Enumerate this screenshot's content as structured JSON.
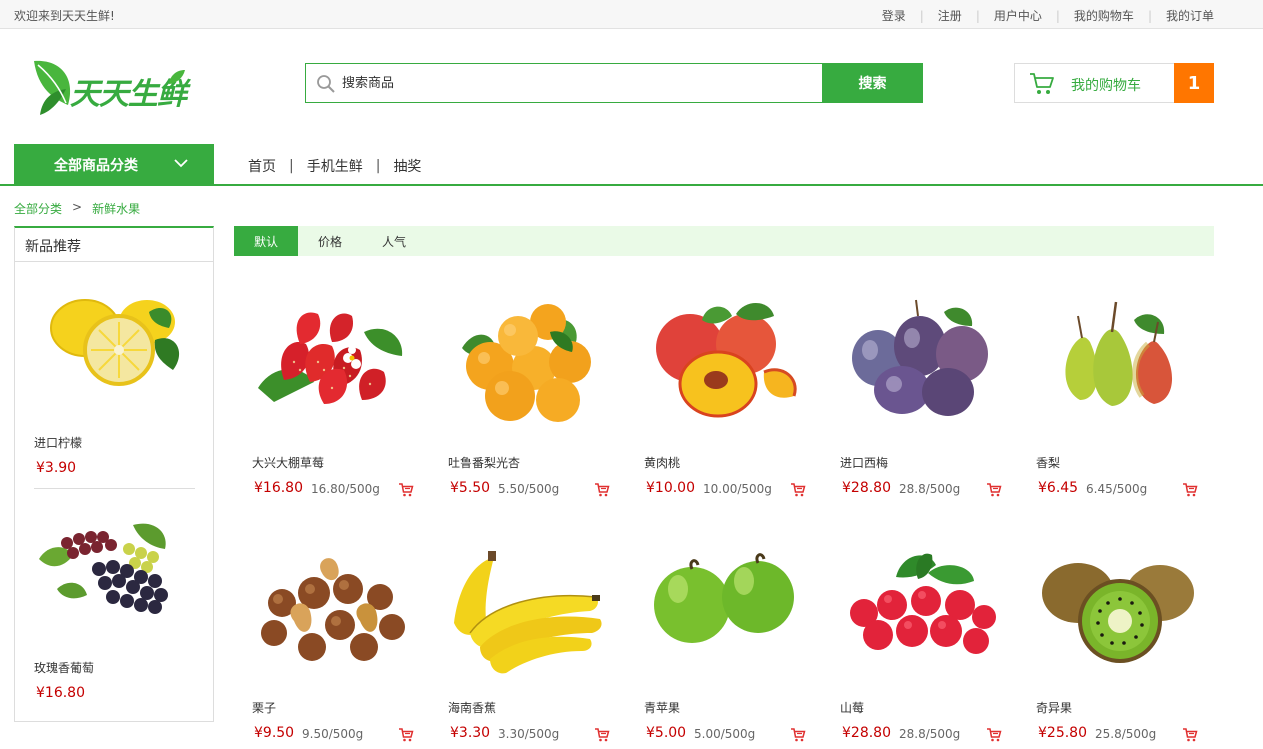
{
  "topbar": {
    "welcome": "欢迎来到天天生鲜!",
    "links": [
      "登录",
      "注册",
      "用户中心",
      "我的购物车",
      "我的订单"
    ]
  },
  "header": {
    "logo_text": "天天生鲜",
    "search_placeholder": "搜索商品",
    "search_button": "搜索",
    "cart_label": "我的购物车",
    "cart_count": "1"
  },
  "nav": {
    "all_categories": "全部商品分类",
    "links": [
      "首页",
      "手机生鲜",
      "抽奖"
    ]
  },
  "breadcrumb": {
    "root": "全部分类",
    "arrow": ">",
    "current": "新鲜水果"
  },
  "sidebar": {
    "title": "新品推荐",
    "items": [
      {
        "name": "进口柠檬",
        "price": "¥3.90",
        "icon": "lemon"
      },
      {
        "name": "玫瑰香葡萄",
        "price": "¥16.80",
        "icon": "grapes"
      }
    ]
  },
  "sort": {
    "items": [
      "默认",
      "价格",
      "人气"
    ],
    "active": "默认"
  },
  "products": [
    {
      "name": "大兴大棚草莓",
      "price": "¥16.80",
      "unit": "16.80/500g",
      "icon": "strawberry"
    },
    {
      "name": "吐鲁番梨光杏",
      "price": "¥5.50",
      "unit": "5.50/500g",
      "icon": "apricot"
    },
    {
      "name": "黄肉桃",
      "price": "¥10.00",
      "unit": "10.00/500g",
      "icon": "peach"
    },
    {
      "name": "进口西梅",
      "price": "¥28.80",
      "unit": "28.8/500g",
      "icon": "plum"
    },
    {
      "name": "香梨",
      "price": "¥6.45",
      "unit": "6.45/500g",
      "icon": "pear"
    },
    {
      "name": "栗子",
      "price": "¥9.50",
      "unit": "9.50/500g",
      "icon": "chestnut"
    },
    {
      "name": "海南香蕉",
      "price": "¥3.30",
      "unit": "3.30/500g",
      "icon": "banana"
    },
    {
      "name": "青苹果",
      "price": "¥5.00",
      "unit": "5.00/500g",
      "icon": "green-apple"
    },
    {
      "name": "山莓",
      "price": "¥28.80",
      "unit": "28.8/500g",
      "icon": "raspberry"
    },
    {
      "name": "奇异果",
      "price": "¥25.80",
      "unit": "25.8/500g",
      "icon": "kiwi"
    }
  ],
  "colors": {
    "accent": "#37ab40",
    "price": "#c40000",
    "badge": "#ff7600",
    "sort_bg": "#eafae7"
  }
}
